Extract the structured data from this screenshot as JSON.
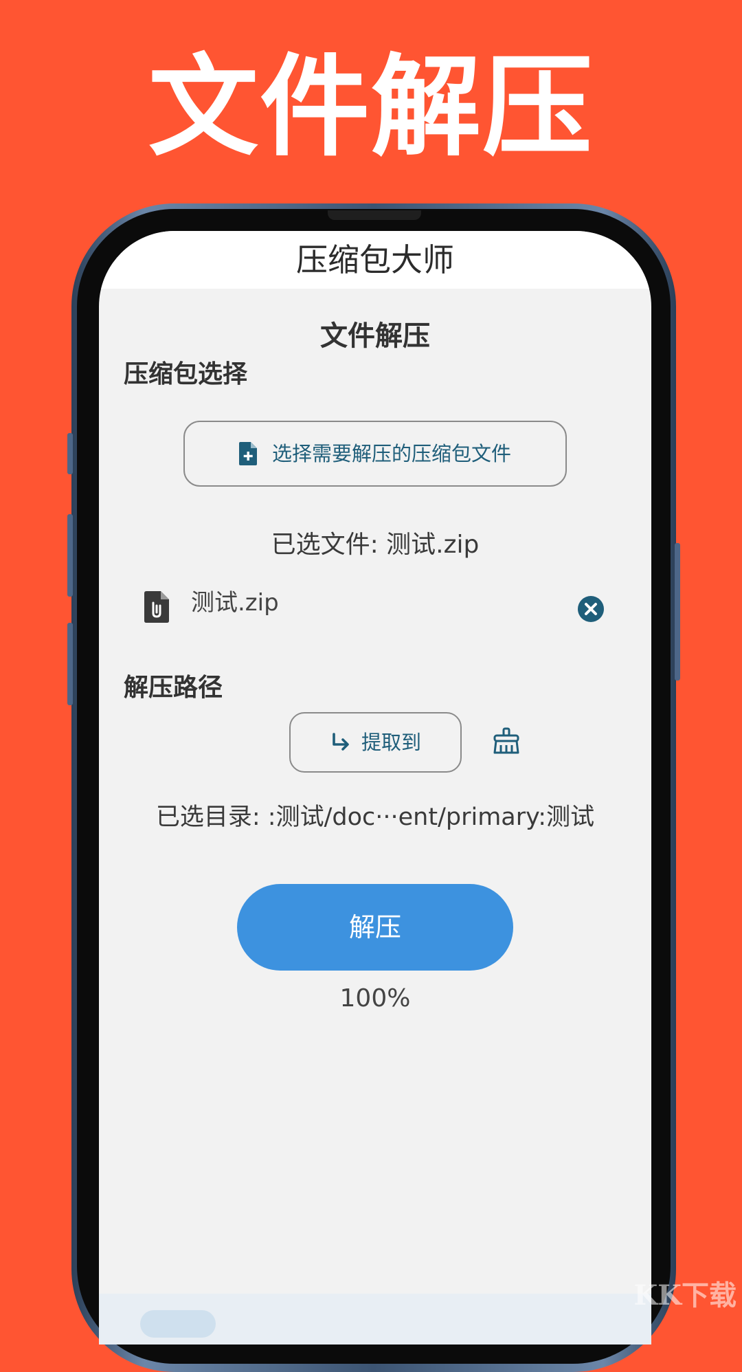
{
  "promo": {
    "title": "文件解压"
  },
  "app": {
    "title": "压缩包大师"
  },
  "page": {
    "heading": "文件解压"
  },
  "archive_section": {
    "label": "压缩包选择",
    "select_button_label": "选择需要解压的压缩包文件",
    "selected_summary": "已选文件: 测试.zip",
    "selected_file_name": "测试.zip"
  },
  "path_section": {
    "label": "解压路径",
    "extract_to_label": "提取到",
    "selected_dir_summary": "已选目录: :测试/doc···ent/primary:测试"
  },
  "action": {
    "extract_label": "解压",
    "progress_text": "100%",
    "progress": 1.0
  },
  "watermark": {
    "text": "KK下载"
  },
  "colors": {
    "background": "#FF5532",
    "accent": "#3D92DF",
    "icon_teal": "#1f5e7a",
    "screen_bg": "#f2f2f2"
  },
  "icons": {
    "select_file": "file-plus-icon",
    "archive_file": "file-zip-icon",
    "remove": "close-circle-icon",
    "extract_to": "arrow-turn-down-right-icon",
    "clear": "broom-icon"
  }
}
